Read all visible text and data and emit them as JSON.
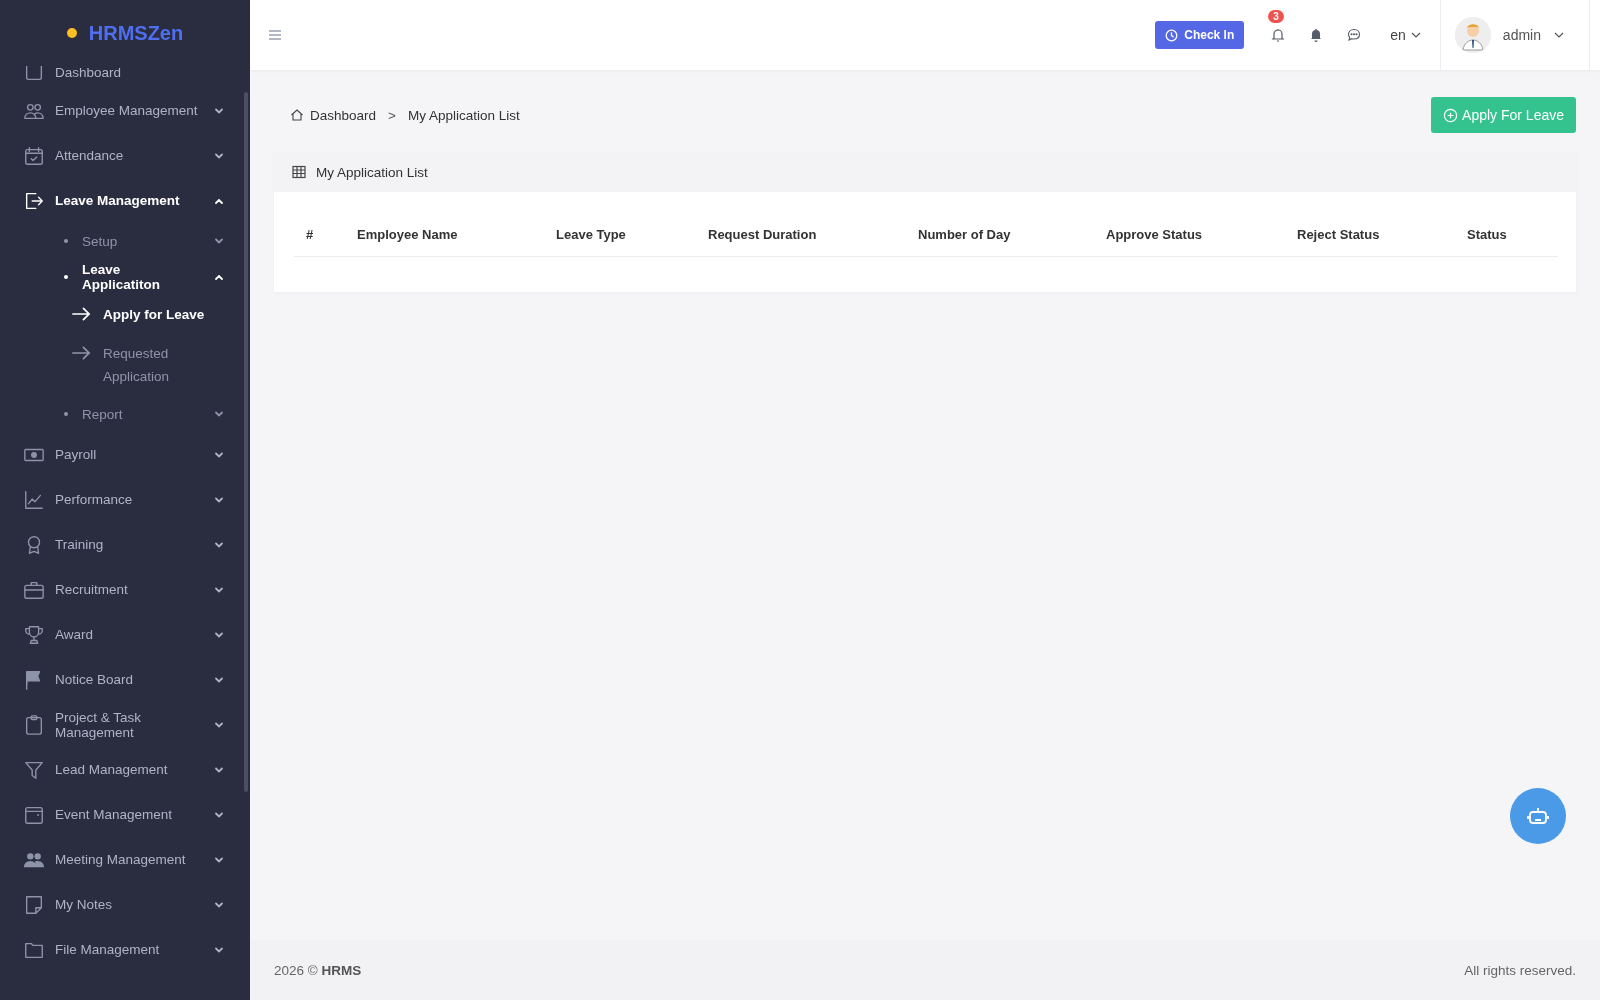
{
  "brand": {
    "name": "HRMSZen"
  },
  "sidebar": {
    "items": [
      {
        "label": "Dashboard",
        "selected": false
      },
      {
        "label": "Employee Management",
        "selected": false,
        "expanded": false
      },
      {
        "label": "Attendance",
        "selected": false,
        "expanded": false
      },
      {
        "label": "Leave Management",
        "selected": true,
        "expanded": true,
        "children": [
          {
            "label": "Setup",
            "selected": false,
            "expanded": false
          },
          {
            "label": "Leave Applicatiton",
            "selected": true,
            "expanded": true,
            "children": [
              {
                "label": "Apply for Leave",
                "selected": true
              },
              {
                "label": "Requested Application",
                "selected": false
              }
            ]
          },
          {
            "label": "Report",
            "selected": false,
            "expanded": false
          }
        ]
      },
      {
        "label": "Payroll",
        "selected": false,
        "expanded": false
      },
      {
        "label": "Performance",
        "selected": false,
        "expanded": false
      },
      {
        "label": "Training",
        "selected": false,
        "expanded": false
      },
      {
        "label": "Recruitment",
        "selected": false,
        "expanded": false
      },
      {
        "label": "Award",
        "selected": false,
        "expanded": false
      },
      {
        "label": "Notice Board",
        "selected": false,
        "expanded": false
      },
      {
        "label": "Project & Task Management",
        "selected": false,
        "expanded": false
      },
      {
        "label": "Lead Management",
        "selected": false,
        "expanded": false
      },
      {
        "label": "Event Management",
        "selected": false,
        "expanded": false
      },
      {
        "label": "Meeting Management",
        "selected": false,
        "expanded": false
      },
      {
        "label": "My Notes",
        "selected": false,
        "expanded": false
      },
      {
        "label": "File Management",
        "selected": false,
        "expanded": false
      }
    ]
  },
  "header": {
    "check_in": "Check In",
    "notification_count": "3",
    "language": "en",
    "user": "admin"
  },
  "breadcrumb": [
    "Dashboard",
    ">",
    "My Application List"
  ],
  "apply_button": "Apply For Leave",
  "card": {
    "title": "My Application List",
    "table": {
      "columns": [
        "#",
        "Employee Name",
        "Leave Type",
        "Request Duration",
        "Number of Day",
        "Approve Status",
        "Reject Status",
        "Status"
      ]
    }
  },
  "footer": {
    "left": "2026 © **HRMS**",
    "right": "All rights reserved."
  }
}
